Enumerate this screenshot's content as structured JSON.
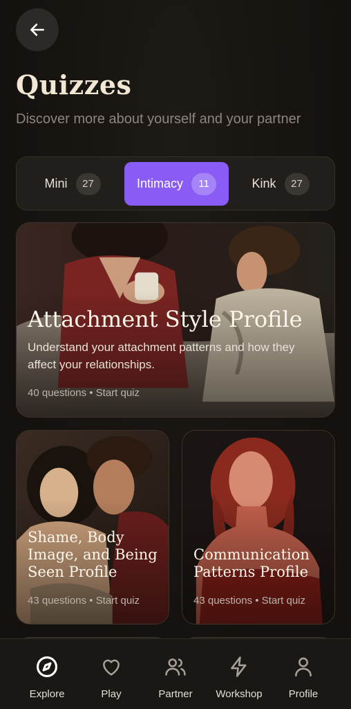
{
  "header": {
    "title": "Quizzes",
    "subtitle": "Discover more about yourself and your partner"
  },
  "tabs": [
    {
      "label": "Mini",
      "count": "27"
    },
    {
      "label": "Intimacy",
      "count": "11"
    },
    {
      "label": "Kink",
      "count": "27"
    }
  ],
  "featured": {
    "title": "Attachment Style Profile",
    "description": "Understand your attachment patterns and how they affect your relationships.",
    "meta": "40 questions • Start quiz"
  },
  "cards": [
    {
      "title": "Shame, Body Image, and Being Seen Profile",
      "meta": "43 questions • Start quiz"
    },
    {
      "title": "Communication Patterns Profile",
      "meta": "43 questions • Start quiz"
    }
  ],
  "nav": [
    {
      "label": "Explore",
      "icon": "compass-icon"
    },
    {
      "label": "Play",
      "icon": "heart-icon"
    },
    {
      "label": "Partner",
      "icon": "users-icon"
    },
    {
      "label": "Workshop",
      "icon": "lightning-icon"
    },
    {
      "label": "Profile",
      "icon": "user-icon"
    }
  ],
  "colors": {
    "accent": "#8a5cf5",
    "background": "#16130f",
    "title": "#f2e7d2"
  }
}
